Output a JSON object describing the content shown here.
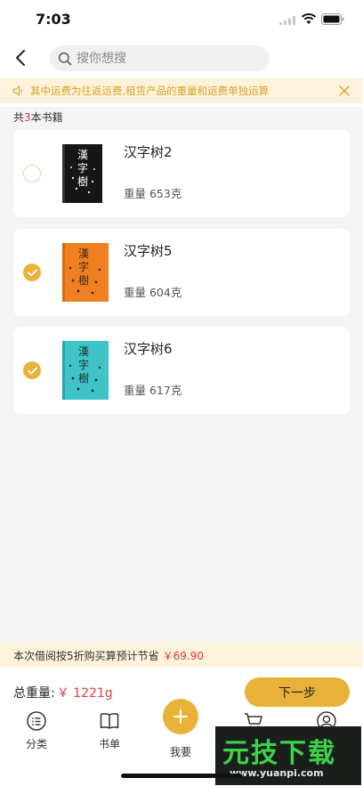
{
  "status": {
    "time": "7:03"
  },
  "search": {
    "placeholder": "搜你想搜"
  },
  "notice": {
    "text": "其中运费为往返运费,租赁产品的重量和运费单独运算"
  },
  "book_count": {
    "prefix": "共",
    "count": "3",
    "suffix": "本书籍"
  },
  "books": [
    {
      "title": "汉字树2",
      "weight": "重量 653克",
      "selected": false,
      "cover_color": "#1a1a1a"
    },
    {
      "title": "汉字树5",
      "weight": "重量 604克",
      "selected": true,
      "cover_color": "#f07f22"
    },
    {
      "title": "汉字树6",
      "weight": "重量 617克",
      "selected": true,
      "cover_color": "#3fc3c8"
    }
  ],
  "savings": {
    "text": "本次借阅按5折购买算预计节省",
    "amount": "￥69.90"
  },
  "total": {
    "label": "总重量:",
    "value": "￥ 1221g"
  },
  "next_button": "下一步",
  "tabs": [
    {
      "label": "分类",
      "icon": "category-icon"
    },
    {
      "label": "书单",
      "icon": "book-list-icon"
    },
    {
      "label": "我要",
      "icon": "plus-icon"
    },
    {
      "label": "",
      "icon": "cart-icon"
    },
    {
      "label": "",
      "icon": "profile-icon"
    }
  ],
  "watermark": {
    "brand": "元技下载",
    "url": "www.yuanpi.com"
  },
  "colors": {
    "accent": "#e9b33a",
    "price": "#e43a3a",
    "notice_bg": "#fdf3dc"
  }
}
